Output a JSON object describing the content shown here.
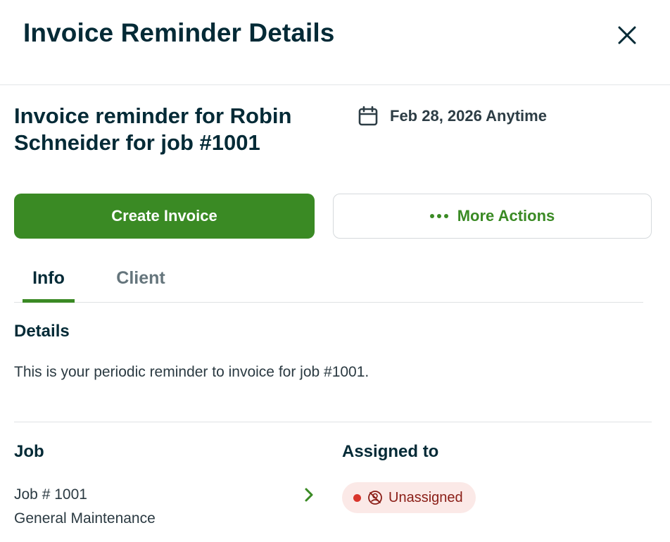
{
  "modal": {
    "title": "Invoice Reminder Details"
  },
  "task": {
    "title": "Invoice reminder for Robin Schneider for job #1001",
    "date": "Feb 28, 2026 Anytime"
  },
  "actions": {
    "primary_label": "Create Invoice",
    "secondary_label": "More Actions"
  },
  "tabs": [
    {
      "label": "Info",
      "active": true
    },
    {
      "label": "Client",
      "active": false
    }
  ],
  "details": {
    "heading": "Details",
    "text": "This is your periodic reminder to invoice for job #1001."
  },
  "job": {
    "heading": "Job",
    "number": "Job # 1001",
    "type": "General Maintenance"
  },
  "assigned": {
    "heading": "Assigned to",
    "status": "Unassigned"
  },
  "colors": {
    "accent": "#3a8a24",
    "title": "#032a36",
    "unassigned_bg": "#fbe9e7",
    "unassigned_text": "#8a1d16"
  },
  "icons": [
    "close-icon",
    "calendar-icon",
    "more-dots-icon",
    "chevron-right-icon",
    "unassigned-icon"
  ]
}
